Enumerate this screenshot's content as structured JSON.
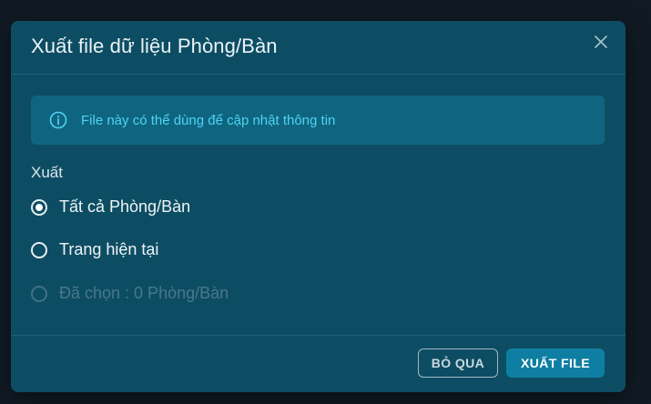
{
  "dialog": {
    "title": "Xuất file dữ liệu Phòng/Bàn",
    "info_text": "File này có thể dùng để cập nhật thông tin",
    "info_icon": "info-circle-icon",
    "close_icon": "close-icon",
    "section_label": "Xuất",
    "options": [
      {
        "label": "Tất cả Phòng/Bàn",
        "checked": true,
        "disabled": false
      },
      {
        "label": "Trang hiện tại",
        "checked": false,
        "disabled": false
      },
      {
        "label": "Đã chọn : 0 Phòng/Bàn",
        "checked": false,
        "disabled": true
      }
    ],
    "cancel_label": "BỎ QUA",
    "export_label": "XUẤT FILE"
  },
  "colors": {
    "backdrop": "#111a24",
    "modal_bg": "#0d4d63",
    "info_bg": "#0f6580",
    "info_text": "#4fd3f2",
    "primary_button": "#0e7fa3"
  }
}
